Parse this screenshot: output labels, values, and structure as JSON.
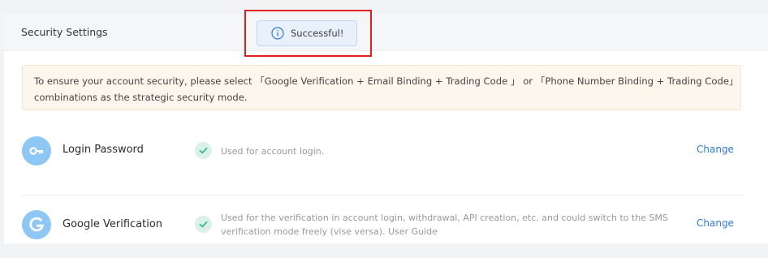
{
  "header": {
    "title": "Security Settings"
  },
  "notice": {
    "line1": "To ensure your account security, please select 「Google Verification + Email Binding + Trading Code 」 or 「Phone Number Binding + Trading Code」",
    "line2": "combinations as the strategic security mode."
  },
  "settings": [
    {
      "title": "Login Password",
      "icon": "key-icon",
      "status_icon": "check-icon",
      "description_lines": [
        "Used for account login."
      ],
      "action_label": "Change"
    },
    {
      "title": "Google Verification",
      "icon": "google-g-icon",
      "status_icon": "check-icon",
      "description_lines": [
        "Used for the verification in account login, withdrawal, API creation, etc. and could switch to the SMS",
        "verification mode freely (vise versa). "
      ],
      "guide_link": "User Guide",
      "action_label": "Change"
    }
  ],
  "toast": {
    "icon": "info-icon",
    "message": "Successful!"
  },
  "colors": {
    "accent": "#2d7bd6",
    "avatar_blue": "#8ec6f4",
    "check_green": "#3fb68b",
    "notice_bg": "#fdf6ec",
    "highlight_red": "#e02020"
  }
}
